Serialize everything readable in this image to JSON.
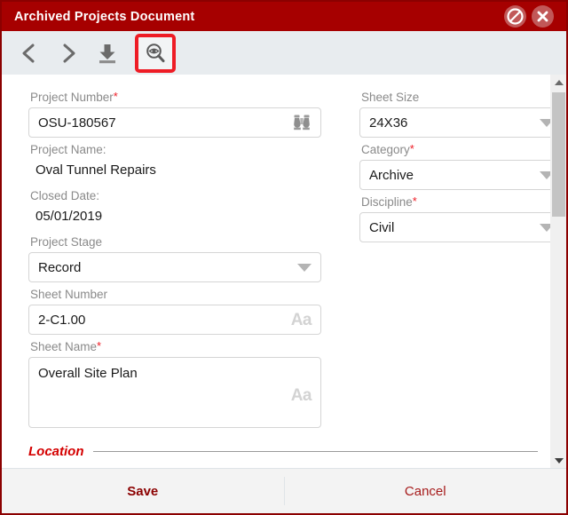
{
  "window": {
    "title": "Archived Projects Document",
    "border_color": "#8b0000",
    "titlebar_color": "#a60000"
  },
  "titlebar_buttons": [
    {
      "name": "block-icon",
      "label": "Block"
    },
    {
      "name": "close-icon",
      "label": "Close"
    }
  ],
  "toolbar": {
    "back_label": "Back",
    "forward_label": "Forward",
    "download_label": "Download",
    "preview_label": "Preview",
    "highlight_color": "#ee1c25"
  },
  "form": {
    "left": {
      "project_number": {
        "label": "Project Number",
        "required": true,
        "value": "OSU-180567",
        "icon": "binoculars-icon"
      },
      "project_name": {
        "label": "Project Name:",
        "required": false,
        "value": "Oval Tunnel Repairs"
      },
      "closed_date": {
        "label": "Closed Date:",
        "required": false,
        "value": "05/01/2019"
      },
      "project_stage": {
        "label": "Project Stage",
        "required": false,
        "value": "Record"
      },
      "sheet_number": {
        "label": "Sheet Number",
        "required": false,
        "value": "2-C1.00",
        "icon": "aa-icon",
        "icon_text": "Aa"
      },
      "sheet_name": {
        "label": "Sheet Name",
        "required": true,
        "value": "Overall Site Plan",
        "icon": "aa-icon",
        "icon_text": "Aa"
      }
    },
    "right": {
      "sheet_size": {
        "label": "Sheet Size",
        "required": false,
        "value": "24X36"
      },
      "category": {
        "label": "Category",
        "required": true,
        "value": "Archive"
      },
      "discipline": {
        "label": "Discipline",
        "required": true,
        "value": "Civil"
      }
    },
    "section": {
      "location_title": "Location",
      "location_color": "#d40000"
    },
    "required_marker": "*"
  },
  "footer": {
    "save_label": "Save",
    "cancel_label": "Cancel"
  }
}
